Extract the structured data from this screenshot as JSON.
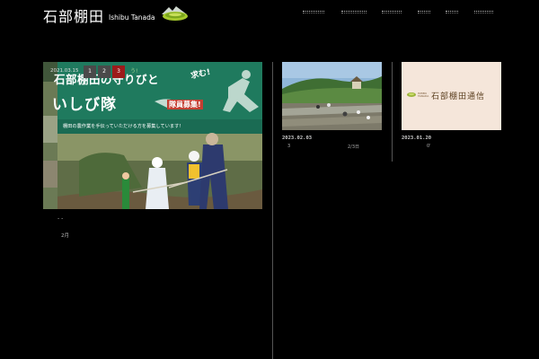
{
  "header": {
    "logo_kanji": "石部棚田",
    "logo_roman": "Ishibu Tanada",
    "nav": [
      {
        "label": ""
      },
      {
        "label": ""
      },
      {
        "label": ""
      },
      {
        "label": ""
      },
      {
        "label": ""
      },
      {
        "label": ""
      }
    ]
  },
  "slider": {
    "date": "2021.03.15",
    "pages": [
      "1",
      "2",
      "3"
    ],
    "active_page": "3",
    "tail_text": "う!",
    "banner": {
      "title": "石部棚田の守りびと",
      "motomu": "求む!",
      "title2": "いしび隊",
      "badge": "隊員募集!",
      "subtitle": "棚田の農作業を手伝っていただける方を募集しています!"
    },
    "caption": "-   -",
    "caption_num": "2月"
  },
  "cards": [
    {
      "date": "2023.02.03",
      "excerpt_left": "3",
      "excerpt_right": "2/3日"
    },
    {
      "date": "2023.01.20",
      "excerpt_left": "0'",
      "tsushin_title": "石部棚田通信",
      "tsushin_sub": "ISHIBU TANADA"
    }
  ],
  "colors": {
    "background": "#000000",
    "active_pager": "#9c1b1b",
    "banner_green": "#1e7a5e",
    "badge_red": "#c43f32"
  }
}
